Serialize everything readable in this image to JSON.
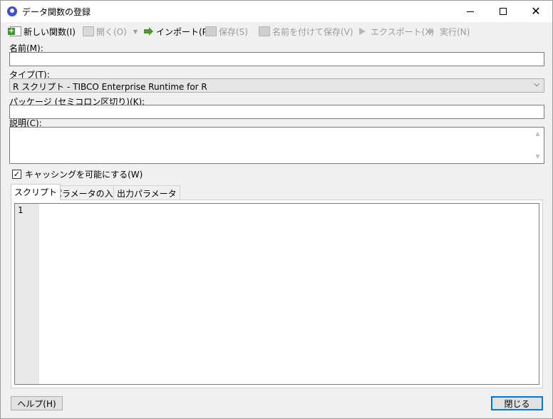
{
  "window": {
    "title": "データ関数の登録"
  },
  "toolbar": {
    "new_label": "新しい関数(I)",
    "open_label": "開く(O)",
    "import_label": "インポート(P)",
    "save_label": "保存(S)",
    "saveas_label": "名前を付けて保存(V)",
    "export_label": "エクスポート(X)",
    "run_label": "実行(N)"
  },
  "form": {
    "name_label": "名前(M):",
    "name_value": "",
    "type_label": "タイプ(T):",
    "type_value": "R スクリプト - TIBCO Enterprise Runtime for R",
    "package_label": "パッケージ (セミコロン区切り)(K):",
    "package_value": "",
    "desc_label": "説明(C):",
    "desc_value": "",
    "caching_label": "キャッシングを可能にする(W)",
    "caching_checked": "✓"
  },
  "tabs": [
    {
      "label": "スクリプト"
    },
    {
      "label": "パラメータの入力"
    },
    {
      "label": "出力パラメータ"
    }
  ],
  "editor": {
    "line_number": "1"
  },
  "buttons": {
    "help_label": "ヘルプ(H)",
    "close_label": "閉じる"
  }
}
